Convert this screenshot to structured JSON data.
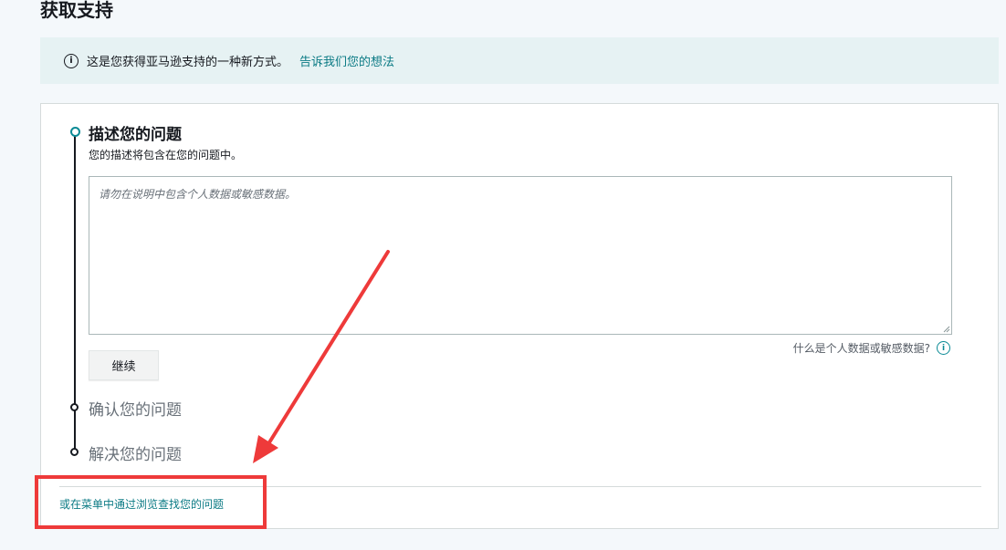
{
  "page": {
    "title": "获取支持"
  },
  "banner": {
    "icon": "info-icon",
    "text": "这是您获得亚马逊支持的一种新方式。",
    "link": "告诉我们您的想法"
  },
  "steps": [
    {
      "title": "描述您的问题",
      "description": "您的描述将包含在您的问题中。",
      "status": "active"
    },
    {
      "title": "确认您的问题",
      "status": "pending"
    },
    {
      "title": "解决您的问题",
      "status": "pending"
    }
  ],
  "form": {
    "textarea_value": "",
    "textarea_placeholder": "请勿在说明中包含个人数据或敏感数据。",
    "sensitive_help": "什么是个人数据或敏感数据?",
    "continue_label": "继续"
  },
  "footer": {
    "browse_link": "或在菜单中通过浏览查找您的问题"
  },
  "annotation": {
    "color": "#ee3a3a"
  },
  "colors": {
    "accent": "#0a8a95",
    "link": "#0a7a84",
    "banner_bg": "#e6f2f3"
  }
}
